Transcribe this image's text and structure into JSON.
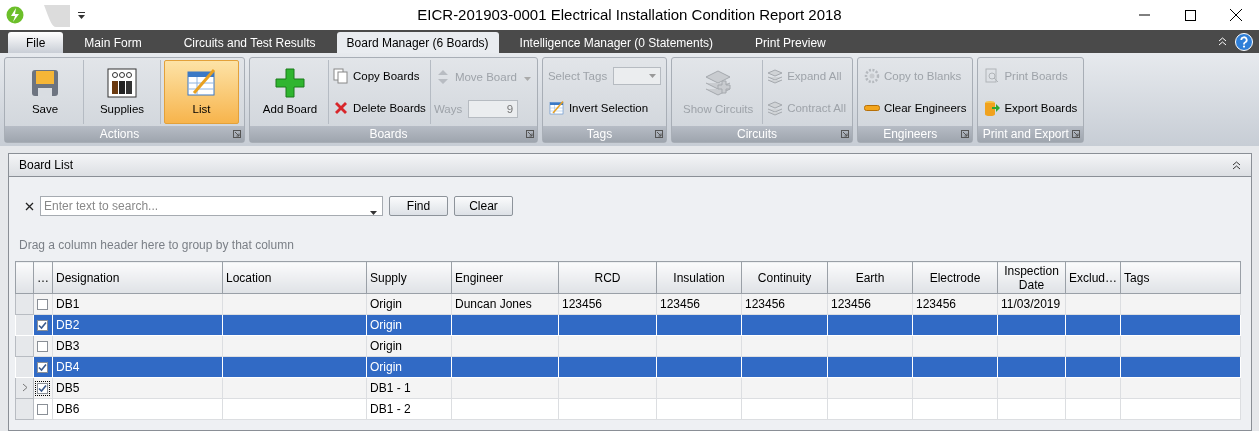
{
  "window": {
    "title": "EICR-201903-0001 Electrical Installation Condition Report 2018"
  },
  "tabs": [
    {
      "label": "File",
      "kind": "file",
      "selected": false
    },
    {
      "label": "Main Form",
      "kind": "page",
      "selected": false
    },
    {
      "label": "Circuits and Test Results",
      "kind": "page",
      "selected": false
    },
    {
      "label": "Board Manager (6 Boards)",
      "kind": "page",
      "selected": true
    },
    {
      "label": "Intelligence Manager (0 Statements)",
      "kind": "page",
      "selected": false
    },
    {
      "label": "Print Preview",
      "kind": "page",
      "selected": false
    }
  ],
  "ribbon": {
    "groups": [
      {
        "title": "Actions",
        "columns": [
          [
            {
              "kind": "large",
              "label": "Save",
              "disabled": false,
              "selected": false
            }
          ],
          [
            {
              "kind": "large",
              "label": "Supplies",
              "disabled": false,
              "selected": false
            }
          ],
          [
            {
              "kind": "large",
              "label": "List",
              "disabled": false,
              "selected": true
            }
          ]
        ]
      },
      {
        "title": "Boards",
        "columns": [
          [
            {
              "kind": "large",
              "label": "Add Board",
              "disabled": false,
              "selected": false
            }
          ],
          [
            {
              "kind": "small",
              "label": "Copy Boards",
              "disabled": false
            },
            {
              "kind": "small",
              "label": "Delete Boards",
              "disabled": false
            }
          ],
          [
            {
              "kind": "dropdown",
              "label": "Move Board",
              "disabled": true
            },
            {
              "kind": "spin",
              "label": "Ways",
              "value": "9",
              "disabled": true
            }
          ]
        ]
      },
      {
        "title": "Tags",
        "columns": [
          [
            {
              "kind": "combo",
              "label": "Select Tags",
              "disabled": true
            },
            {
              "kind": "small",
              "label": "Invert Selection",
              "disabled": false
            }
          ]
        ]
      },
      {
        "title": "Circuits",
        "columns": [
          [
            {
              "kind": "large",
              "label": "Show Circuits",
              "disabled": true,
              "selected": false
            }
          ],
          [
            {
              "kind": "small",
              "label": "Expand All",
              "disabled": true
            },
            {
              "kind": "small",
              "label": "Contract All",
              "disabled": true
            }
          ]
        ]
      },
      {
        "title": "Engineers",
        "columns": [
          [
            {
              "kind": "small",
              "label": "Copy to Blanks",
              "disabled": true
            },
            {
              "kind": "small",
              "label": "Clear Engineers",
              "disabled": false
            }
          ]
        ]
      },
      {
        "title": "Print and Export",
        "columns": [
          [
            {
              "kind": "small",
              "label": "Print Boards",
              "disabled": true
            },
            {
              "kind": "small",
              "label": "Export Boards",
              "disabled": false
            }
          ]
        ]
      }
    ]
  },
  "panel": {
    "title": "Board List",
    "search": {
      "placeholder": "Enter text to search...",
      "buttons": [
        "Find",
        "Clear"
      ]
    },
    "group_hint": "Drag a column header here to group by that column",
    "table": {
      "check_column": "…",
      "columns": [
        "Designation",
        "Location",
        "Supply",
        "Engineer",
        "RCD",
        "Insulation",
        "Continuity",
        "Earth",
        "Electrode",
        "Inspection Date",
        "Exclud…",
        "Tags"
      ],
      "rows": [
        {
          "checked": false,
          "selected": false,
          "focused": false,
          "cells": [
            "DB1",
            "",
            "Origin",
            "Duncan Jones",
            "123456",
            "123456",
            "123456",
            "123456",
            "123456",
            "11/03/2019",
            "",
            ""
          ]
        },
        {
          "checked": true,
          "selected": true,
          "focused": false,
          "cells": [
            "DB2",
            "",
            "Origin",
            "",
            "",
            "",
            "",
            "",
            "",
            "",
            "",
            ""
          ]
        },
        {
          "checked": false,
          "selected": false,
          "focused": false,
          "cells": [
            "DB3",
            "",
            "Origin",
            "",
            "",
            "",
            "",
            "",
            "",
            "",
            "",
            ""
          ]
        },
        {
          "checked": true,
          "selected": true,
          "focused": false,
          "cells": [
            "DB4",
            "",
            "Origin",
            "",
            "",
            "",
            "",
            "",
            "",
            "",
            "",
            ""
          ]
        },
        {
          "checked": true,
          "selected": false,
          "focused": true,
          "cells": [
            "DB5",
            "",
            "DB1 - 1",
            "",
            "",
            "",
            "",
            "",
            "",
            "",
            "",
            ""
          ]
        },
        {
          "checked": false,
          "selected": false,
          "focused": false,
          "cells": [
            "DB6",
            "",
            "DB1 - 2",
            "",
            "",
            "",
            "",
            "",
            "",
            "",
            "",
            ""
          ]
        }
      ]
    }
  }
}
